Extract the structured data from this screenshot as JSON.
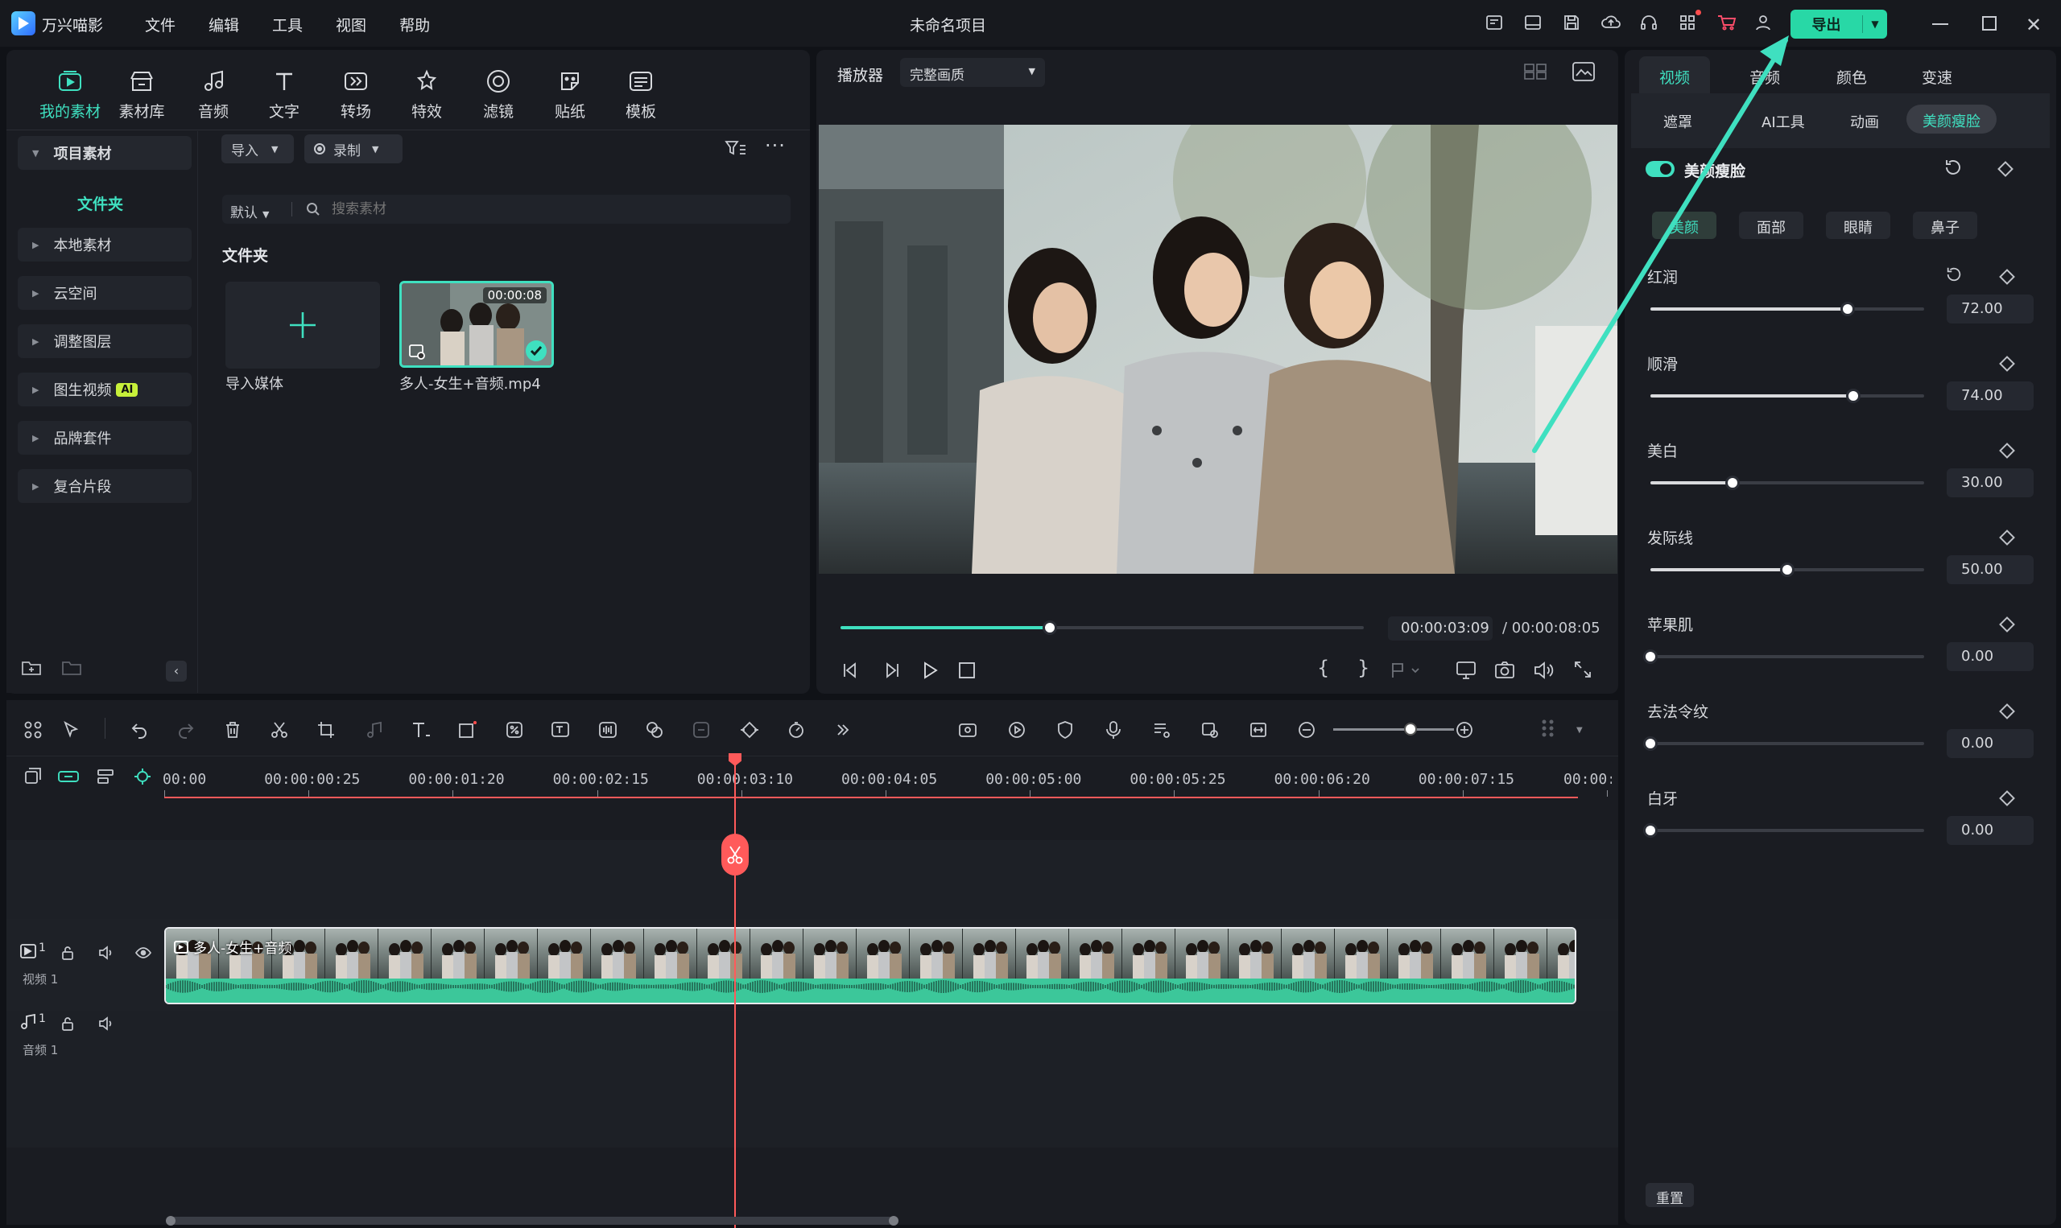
{
  "app": {
    "name": "万兴喵影",
    "project_title": "未命名项目",
    "export_label": "导出"
  },
  "menu": [
    "文件",
    "编辑",
    "工具",
    "视图",
    "帮助"
  ],
  "media_tabs": [
    {
      "label": "我的素材",
      "icon": "my-media-icon",
      "active": true
    },
    {
      "label": "素材库",
      "icon": "stock-library-icon"
    },
    {
      "label": "音频",
      "icon": "audio-icon"
    },
    {
      "label": "文字",
      "icon": "text-icon"
    },
    {
      "label": "转场",
      "icon": "transition-icon"
    },
    {
      "label": "特效",
      "icon": "effects-icon"
    },
    {
      "label": "滤镜",
      "icon": "filter-icon"
    },
    {
      "label": "贴纸",
      "icon": "sticker-icon"
    },
    {
      "label": "模板",
      "icon": "template-icon"
    }
  ],
  "sidebar": {
    "project_media": "项目素材",
    "folder": "文件夹",
    "items": [
      "本地素材",
      "云空间",
      "调整图层",
      "图生视频",
      "品牌套件",
      "复合片段"
    ],
    "ai_badge": "AI"
  },
  "media": {
    "import_label": "导入",
    "record_label": "录制",
    "sort_label": "默认",
    "search_placeholder": "搜索素材",
    "section_title": "文件夹",
    "import_media_label": "导入媒体",
    "clip_name": "多人-女生+音频.mp4",
    "clip_duration": "00:00:08"
  },
  "player": {
    "label": "播放器",
    "quality": "完整画质",
    "current_time": "00:00:03:09",
    "total_time": "/ 00:00:08:05",
    "progress": 0.4
  },
  "right_panel": {
    "tabs": [
      "视频",
      "音频",
      "颜色",
      "变速"
    ],
    "subtabs": [
      "遮罩",
      "AI工具",
      "动画",
      "美颜瘦脸"
    ],
    "section_title": "美颜瘦脸",
    "face_tabs": [
      "美颜",
      "面部",
      "眼睛",
      "鼻子"
    ],
    "params": [
      {
        "label": "红润",
        "value": "72.00",
        "level": 0.72
      },
      {
        "label": "顺滑",
        "value": "74.00",
        "level": 0.74
      },
      {
        "label": "美白",
        "value": "30.00",
        "level": 0.3
      },
      {
        "label": "发际线",
        "value": "50.00",
        "level": 0.5
      },
      {
        "label": "苹果肌",
        "value": "0.00",
        "level": 0
      },
      {
        "label": "去法令纹",
        "value": "0.00",
        "level": 0
      },
      {
        "label": "白牙",
        "value": "0.00",
        "level": 0
      }
    ],
    "reset_label": "重置"
  },
  "timeline": {
    "ticks": [
      "00:00",
      "00:00:00:25",
      "00:00:01:20",
      "00:00:02:15",
      "00:00:03:10",
      "00:00:04:05",
      "00:00:05:00",
      "00:00:05:25",
      "00:00:06:20",
      "00:00:07:15",
      "00:00:0"
    ],
    "video_track": "视频 1",
    "audio_track": "音频 1",
    "track_number": "1",
    "clip_label": "多人-女生+音频"
  },
  "colors": {
    "accent": "#3fe0c0",
    "export_button": "#28d8a6",
    "playhead": "#ff5a5a",
    "audio_wave": "#3cc79a"
  }
}
